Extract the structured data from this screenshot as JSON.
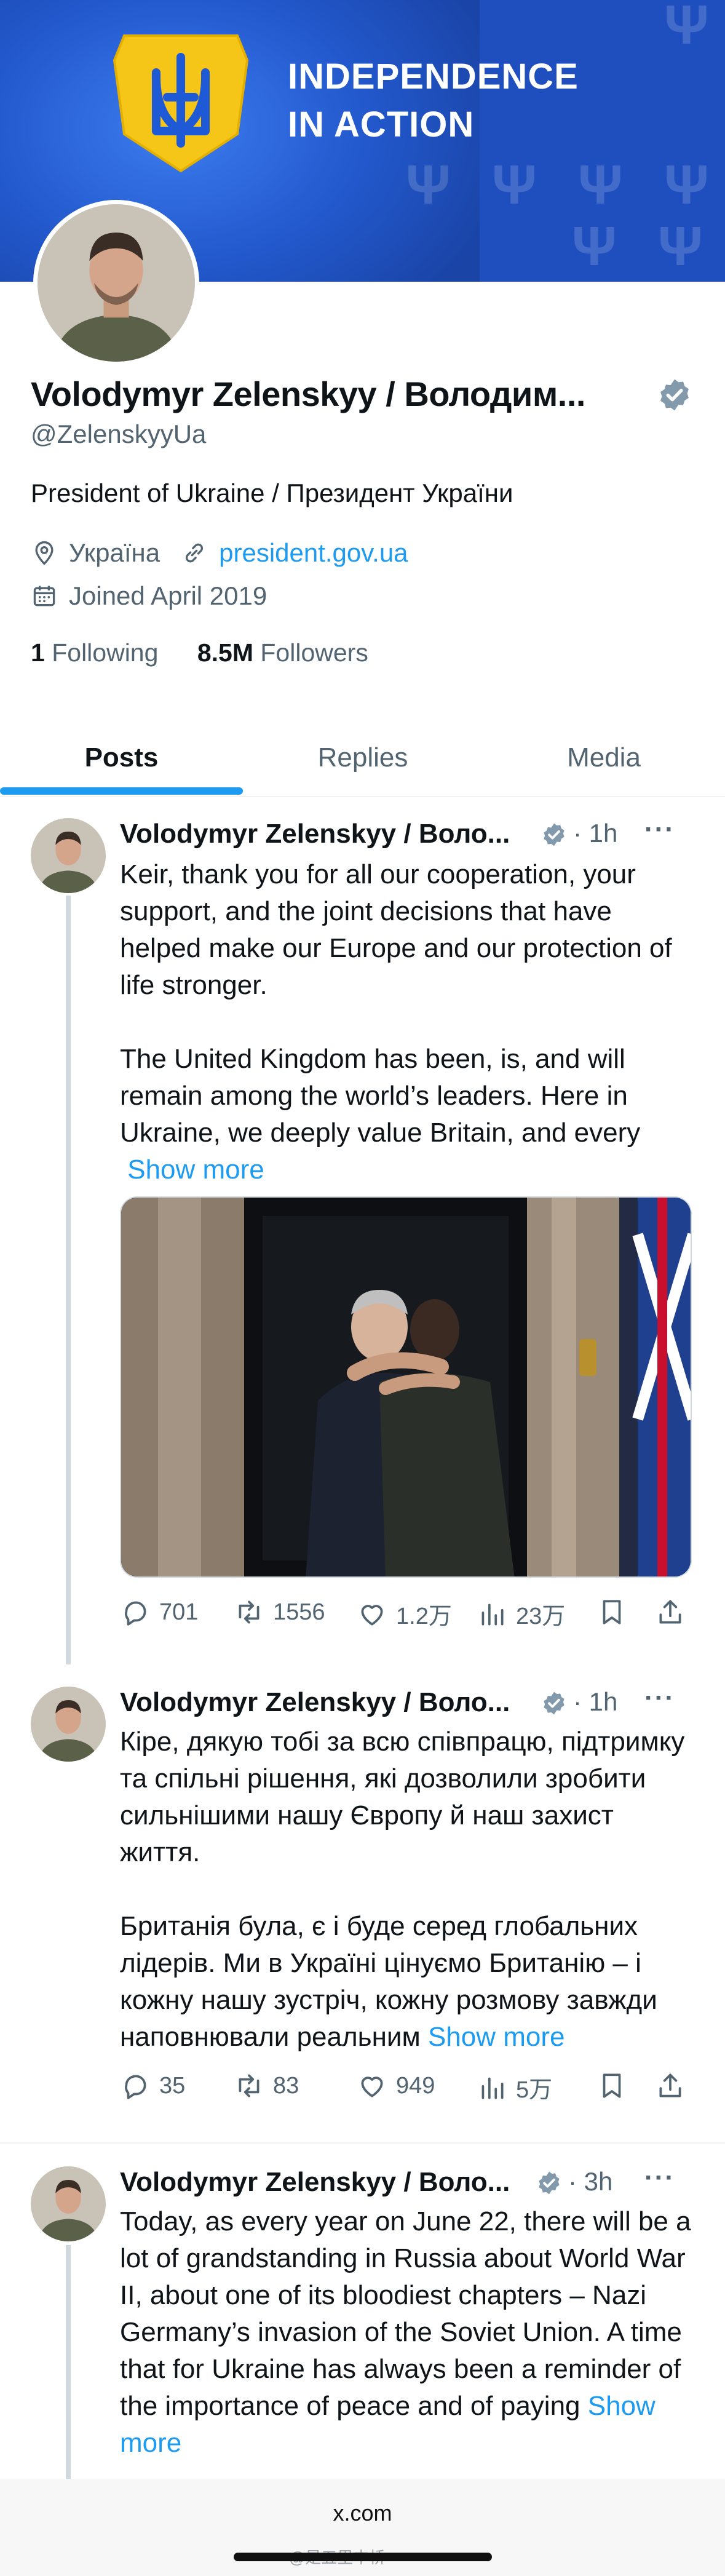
{
  "banner": {
    "title_line1": "INDEPENDENCE",
    "title_line2": "IN ACTION"
  },
  "profile": {
    "name": "Volodymyr Zelenskyy / Володим...",
    "handle": "@ZelenskyyUa",
    "bio": "President of Ukraine / Президент України",
    "location": "Україна",
    "website": "president.gov.ua",
    "joined": "Joined April 2019",
    "following_count": "1",
    "following_label": "Following",
    "followers_count": "8.5M",
    "followers_label": "Followers"
  },
  "tabs": [
    "Posts",
    "Replies",
    "Media"
  ],
  "tweets": [
    {
      "name": "Volodymyr Zelenskyy / Воло...",
      "time": "· 1h",
      "text": "Keir, thank you for all our cooperation, your support, and the joint decisions that have helped make our Europe and our protection of life stronger.\n\nThe United Kingdom has been, is, and will remain among the world’s leaders. Here in Ukraine, we deeply value Britain, and every",
      "show_more": "Show more",
      "replies": "701",
      "reposts": "1556",
      "likes": "1.2万",
      "views": "23万"
    },
    {
      "name": "Volodymyr Zelenskyy / Воло...",
      "time": "· 1h",
      "text": "Кіре, дякую тобі за всю співпрацю, підтримку та спільні рішення, які дозволили зробити сильнішими нашу Європу й наш захист життя.\n\nБританія була, є і буде серед глобальних лідерів. Ми в Україні цінуємо Британію – і кожну нашу зустріч, кожну розмову завжди наповнювали реальним ",
      "show_more": "Show more",
      "replies": "35",
      "reposts": "83",
      "likes": "949",
      "views": "5万"
    },
    {
      "name": "Volodymyr Zelenskyy / Воло...",
      "time": "· 3h",
      "text": "Today, as every year on June 22, there will be a lot of grandstanding in Russia about World War II, about one of its bloodiest chapters – Nazi Germany’s invasion of the Soviet Union. A time that for Ukraine has always been a reminder of the importance of peace and of paying ",
      "show_more": "Show more"
    }
  ],
  "browser": {
    "url": "x.com",
    "watermark": "@是五里中桥"
  },
  "colors": {
    "accent": "#1d9bf0",
    "banner": "#1f4fbf",
    "text": "#0f1419",
    "muted": "#536471"
  }
}
